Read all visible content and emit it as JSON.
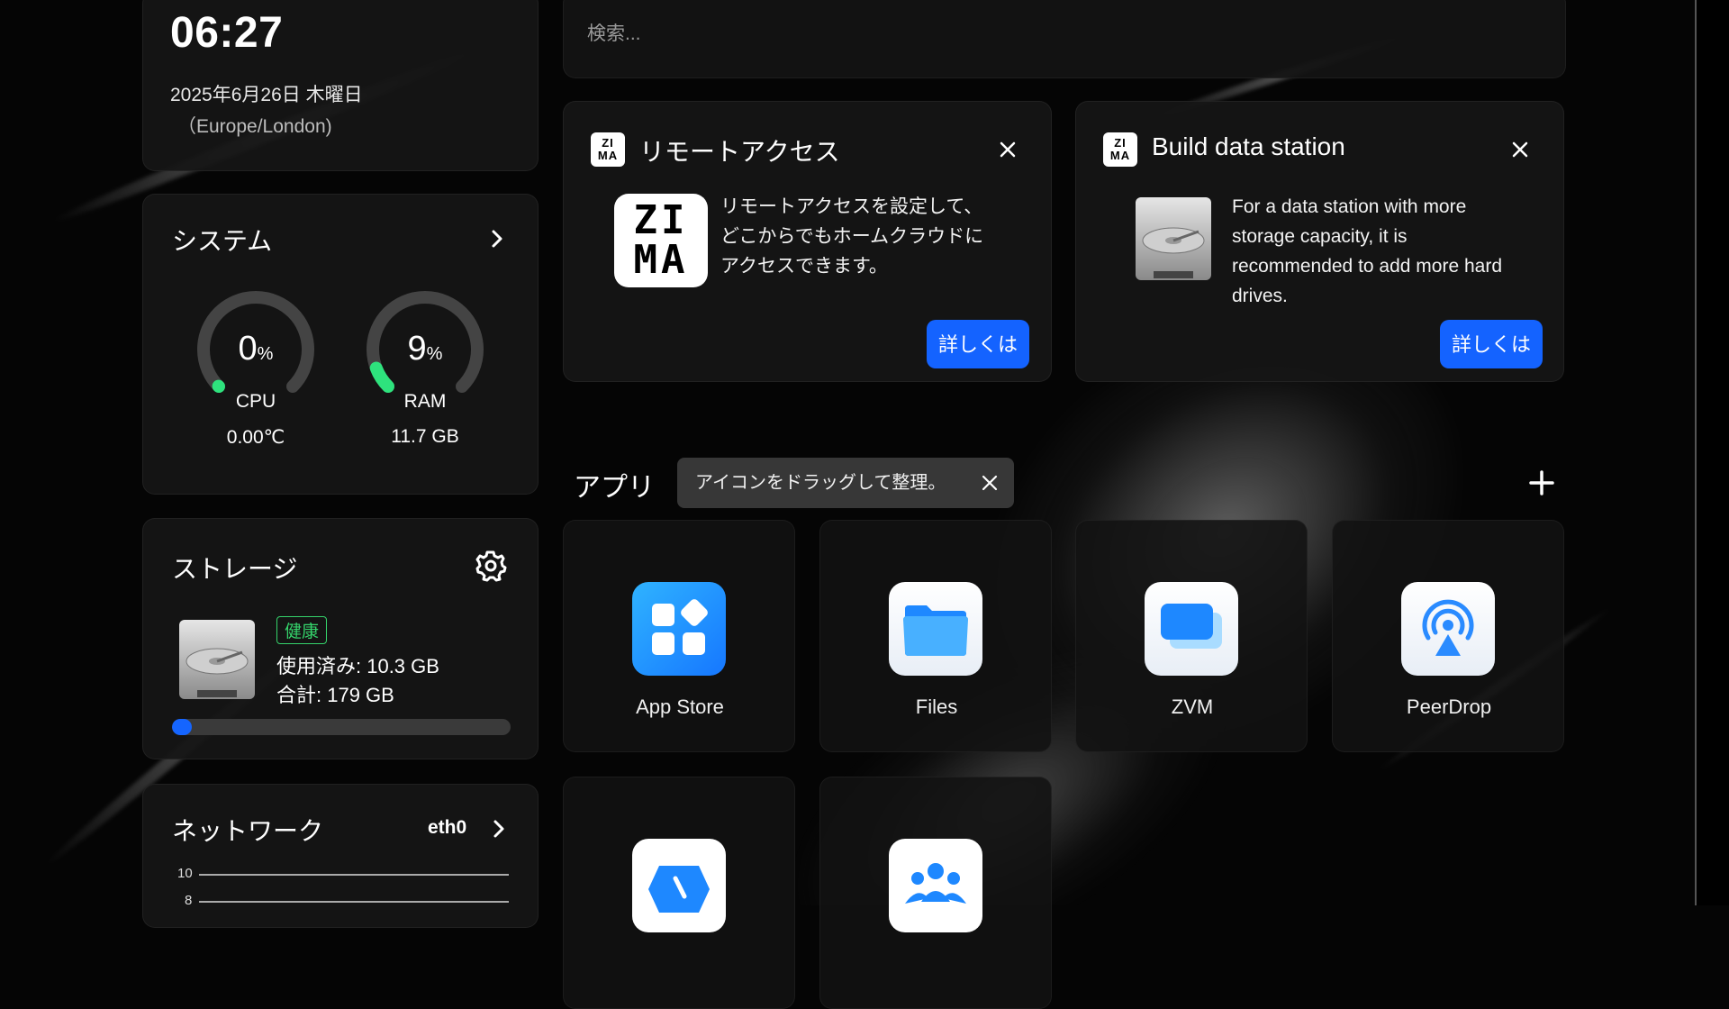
{
  "clock": {
    "time": "06:27",
    "date": "2025年6月26日 木曜日",
    "timezone": "（Europe/London)"
  },
  "system": {
    "title": "システム",
    "cpu": {
      "value": "0",
      "unit": "%",
      "label": "CPU",
      "sub": "0.00℃",
      "percent": 0
    },
    "ram": {
      "value": "9",
      "unit": "%",
      "label": "RAM",
      "sub": "11.7 GB",
      "percent": 9
    },
    "accent": "#2ee27d"
  },
  "storage": {
    "title": "ストレージ",
    "status": "健康",
    "used": "使用済み: 10.3 GB",
    "total": "合計: 179 GB",
    "used_fraction": 0.058
  },
  "network": {
    "title": "ネットワーク",
    "interface": "eth0",
    "ticks": [
      "10",
      "8"
    ]
  },
  "search": {
    "placeholder": "検索..."
  },
  "cards": [
    {
      "title": "リモートアクセス",
      "text": [
        "リモートアクセスを設定して、",
        "どこからでもホームクラウドに",
        "アクセスできます。"
      ],
      "button": "詳しくは",
      "logo_lines": [
        "ZI",
        "MA"
      ]
    },
    {
      "title": "Build data station",
      "text": [
        "For a data station with more",
        "storage capacity, it is",
        "recommended to add more hard",
        "drives."
      ],
      "button": "詳しくは",
      "logo_lines": [
        "ZI",
        "MA"
      ]
    }
  ],
  "apps_section": {
    "title": "アプリ",
    "tooltip": "アイコンをドラッグして整理。"
  },
  "apps": [
    {
      "label": "App Store",
      "icon": "app-store-icon"
    },
    {
      "label": "Files",
      "icon": "folder-icon"
    },
    {
      "label": "ZVM",
      "icon": "zvm-icon"
    },
    {
      "label": "PeerDrop",
      "icon": "peerdrop-icon"
    },
    {
      "label": "",
      "icon": "app-5-icon"
    },
    {
      "label": "",
      "icon": "users-icon"
    }
  ],
  "colors": {
    "accent_blue": "#1463ff",
    "healthy_green": "#35d36b"
  }
}
